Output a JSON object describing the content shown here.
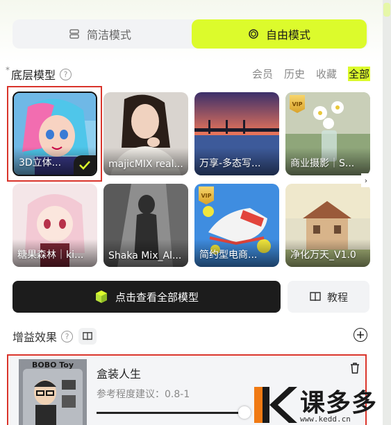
{
  "mode_switch": {
    "simple_label": "简洁模式",
    "free_label": "自由模式",
    "active": "free"
  },
  "base_model": {
    "required_mark": "*",
    "title": "底层模型",
    "help": "?",
    "filters": [
      "会员",
      "历史",
      "收藏",
      "全部"
    ],
    "active_filter": "全部",
    "models": [
      {
        "label": "3D立体...",
        "selected": true,
        "vip": false
      },
      {
        "label": "majicMIX real...",
        "selected": false,
        "vip": false
      },
      {
        "label": "万享-多态写...",
        "selected": false,
        "vip": false
      },
      {
        "label": "商业摄影｜S...",
        "selected": false,
        "vip": true
      },
      {
        "label": "糖果森林｜ki...",
        "selected": false,
        "vip": false
      },
      {
        "label": "Shaka Mix_Al...",
        "selected": false,
        "vip": false
      },
      {
        "label": "简约型电商...",
        "selected": false,
        "vip": true
      },
      {
        "label": "净化万天_V1.0",
        "selected": false,
        "vip": false
      }
    ],
    "next_arrow": "›"
  },
  "buttons": {
    "view_all": "点击查看全部模型",
    "tutorial": "教程"
  },
  "gain_effect": {
    "title": "增益效果",
    "help": "?",
    "effect": {
      "name": "盒装人生",
      "hint": "参考程度建议：0.8-1",
      "thumb_text": "BOBO Toy",
      "strength": 0.8
    }
  },
  "watermark": {
    "text": "课多多",
    "url": "www.kedd.cn"
  },
  "colors": {
    "accent": "#dcfb2c",
    "highlight_frame": "#d9342b",
    "dark_button": "#1c1c1c"
  }
}
